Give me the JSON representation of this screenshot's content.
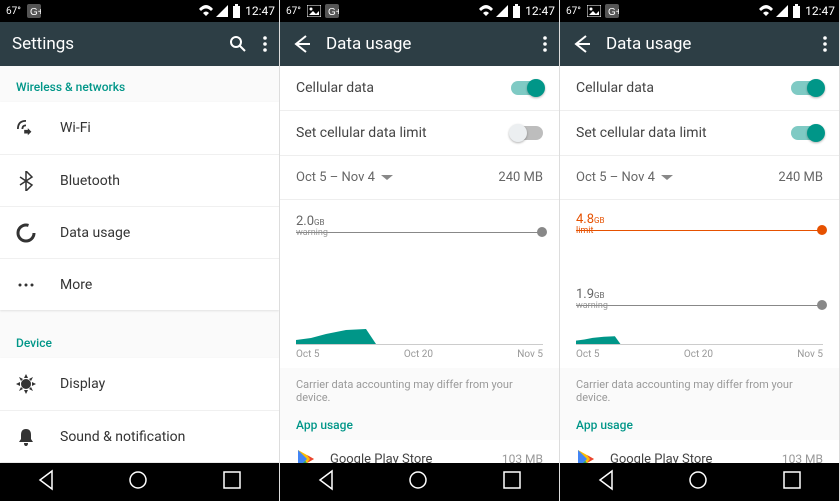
{
  "status": {
    "temp": "67°",
    "time": "12:47"
  },
  "panel1": {
    "title": "Settings",
    "section1": "Wireless & networks",
    "items": [
      {
        "label": "Wi-Fi"
      },
      {
        "label": "Bluetooth"
      },
      {
        "label": "Data usage"
      },
      {
        "label": "More"
      }
    ],
    "section2": "Device",
    "items2": [
      {
        "label": "Display"
      },
      {
        "label": "Sound & notification"
      }
    ]
  },
  "panel2": {
    "title": "Data usage",
    "rows": {
      "cellular": "Cellular data",
      "limit": "Set cellular data limit"
    },
    "period": "Oct 5 – Nov 4",
    "usage": "240 MB",
    "warning_value": "2.0",
    "warning_unit": "GB",
    "warning_label": "warning",
    "ticks": [
      "Oct 5",
      "Oct 20",
      "Nov 5"
    ],
    "disclaimer": "Carrier data accounting may differ from your device.",
    "app_usage_header": "App usage",
    "app": {
      "name": "Google Play Store",
      "usage": "103 MB"
    }
  },
  "panel3": {
    "title": "Data usage",
    "rows": {
      "cellular": "Cellular data",
      "limit": "Set cellular data limit"
    },
    "period": "Oct 5 – Nov 4",
    "usage": "240 MB",
    "limit_value": "4.8",
    "limit_unit": "GB",
    "limit_label": "limit",
    "warning_value": "1.9",
    "warning_unit": "GB",
    "warning_label": "warning",
    "ticks": [
      "Oct 5",
      "Oct 20",
      "Nov 5"
    ],
    "disclaimer": "Carrier data accounting may differ from your device.",
    "app_usage_header": "App usage",
    "app": {
      "name": "Google Play Store",
      "usage": "103 MB"
    }
  },
  "colors": {
    "teal": "#009688",
    "orange": "#e65100"
  }
}
